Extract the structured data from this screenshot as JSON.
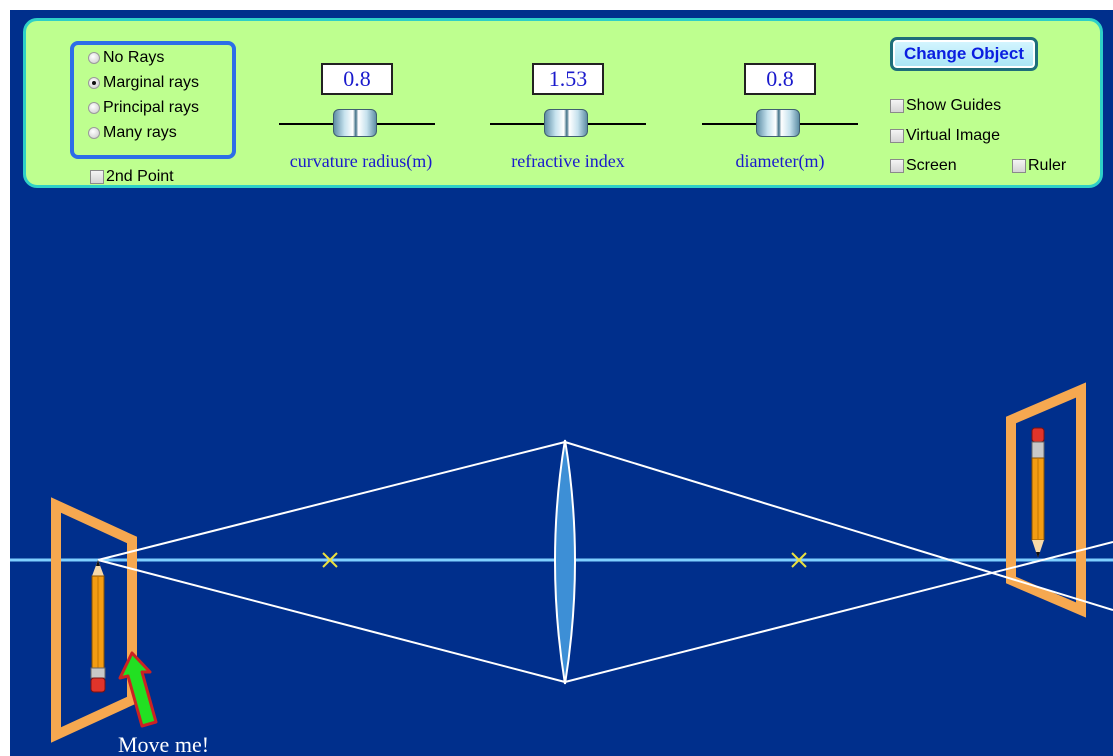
{
  "rays": {
    "options": [
      {
        "label": "No Rays",
        "checked": false
      },
      {
        "label": "Marginal rays",
        "checked": true
      },
      {
        "label": "Principal rays",
        "checked": false
      },
      {
        "label": "Many rays",
        "checked": false
      }
    ],
    "second_point": {
      "label": "2nd Point",
      "checked": false
    }
  },
  "sliders": [
    {
      "value": "0.8",
      "label": "curvature radius(m)"
    },
    {
      "value": "1.53",
      "label": "refractive index"
    },
    {
      "value": "0.8",
      "label": "diameter(m)"
    }
  ],
  "buttons": {
    "change_object": "Change Object"
  },
  "checkboxes": {
    "show_guides": {
      "label": "Show Guides",
      "checked": false
    },
    "virtual_image": {
      "label": "Virtual Image",
      "checked": false
    },
    "screen": {
      "label": "Screen",
      "checked": false
    },
    "ruler": {
      "label": "Ruler",
      "checked": false
    }
  },
  "scene": {
    "hint": "Move me!",
    "icons": [
      "pencil-object-icon",
      "pencil-image-icon",
      "lens-icon",
      "focal-point-icon",
      "move-arrow-icon"
    ]
  },
  "colors": {
    "background": "#002f8c",
    "panel": "#beff8f",
    "panel_border": "#2ed0c7",
    "optical_axis": "#7fd0ff",
    "rays": "#ffffff",
    "focal_marker": "#e8e040",
    "frame": "#f6a850",
    "arrow": "#22e022",
    "label_blue": "#1a1acc"
  }
}
